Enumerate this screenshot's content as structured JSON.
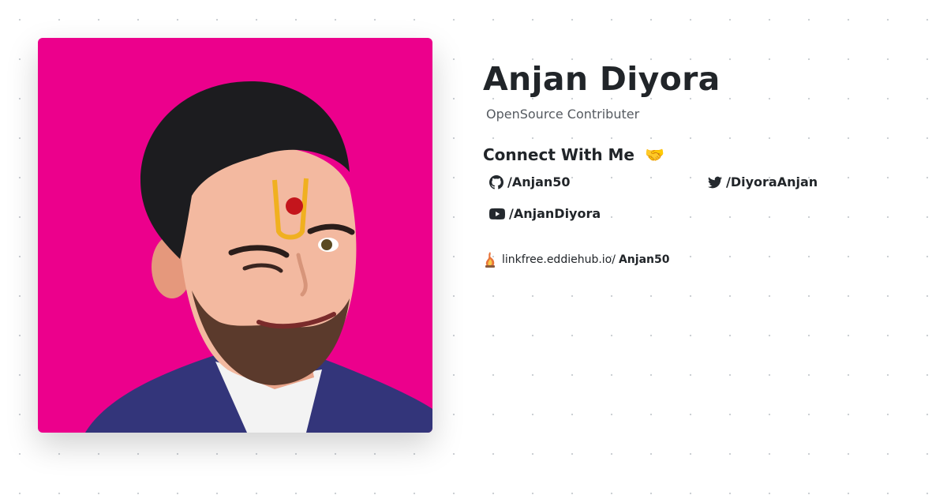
{
  "profile": {
    "name": "Anjan Diyora",
    "bio": "OpenSource Contributer",
    "avatar_background": "#ec008c"
  },
  "connect": {
    "heading": "Connect With Me",
    "emoji": "🤝",
    "links": {
      "github": {
        "icon": "github-icon",
        "label": "/Anjan50"
      },
      "twitter": {
        "icon": "twitter-icon",
        "label": "/DiyoraAnjan"
      },
      "youtube": {
        "icon": "youtube-icon",
        "label": "/AnjanDiyora"
      }
    }
  },
  "linkfree": {
    "icon": "linkfree-logo-icon",
    "domain": "linkfree.eddiehub.io/",
    "username": "Anjan50"
  }
}
